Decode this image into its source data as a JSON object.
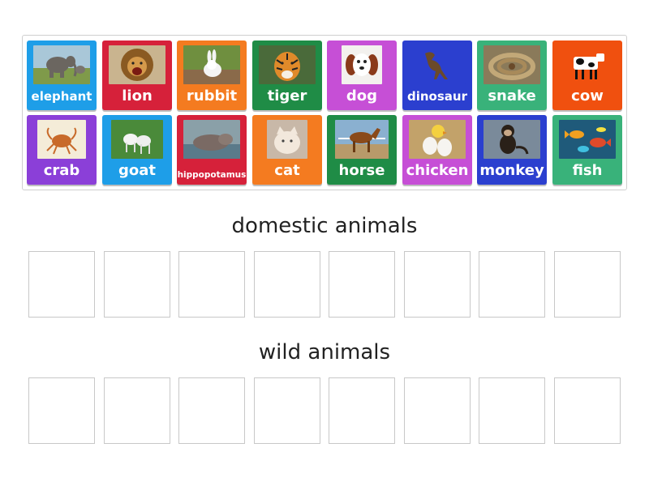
{
  "tiles": [
    {
      "label": "elephant",
      "color": "#1e9ee8",
      "icon": "elephant-image"
    },
    {
      "label": "lion",
      "color": "#d6213a",
      "icon": "lion-image"
    },
    {
      "label": "rubbit",
      "color": "#f47b20",
      "icon": "rabbit-image"
    },
    {
      "label": "tiger",
      "color": "#1f8c46",
      "icon": "tiger-image"
    },
    {
      "label": "dog",
      "color": "#c64fd6",
      "icon": "dog-image"
    },
    {
      "label": "dinosaur",
      "color": "#2b3fcf",
      "icon": "dinosaur-image"
    },
    {
      "label": "snake",
      "color": "#39b27a",
      "icon": "snake-image"
    },
    {
      "label": "cow",
      "color": "#f0500f",
      "icon": "cow-image"
    },
    {
      "label": "crab",
      "color": "#8b3fd8",
      "icon": "crab-image"
    },
    {
      "label": "goat",
      "color": "#1e9ee8",
      "icon": "goat-image"
    },
    {
      "label": "hippopotamus",
      "color": "#d6213a",
      "icon": "hippopotamus-image"
    },
    {
      "label": "cat",
      "color": "#f47b20",
      "icon": "cat-image"
    },
    {
      "label": "horse",
      "color": "#1f8c46",
      "icon": "horse-image"
    },
    {
      "label": "chicken",
      "color": "#c64fd6",
      "icon": "chicken-image"
    },
    {
      "label": "monkey",
      "color": "#2b3fcf",
      "icon": "monkey-image"
    },
    {
      "label": "fish",
      "color": "#39b27a",
      "icon": "fish-image"
    }
  ],
  "groups": [
    {
      "title": "domestic animals",
      "slot_count": 8
    },
    {
      "title": "wild animals",
      "slot_count": 8
    }
  ]
}
